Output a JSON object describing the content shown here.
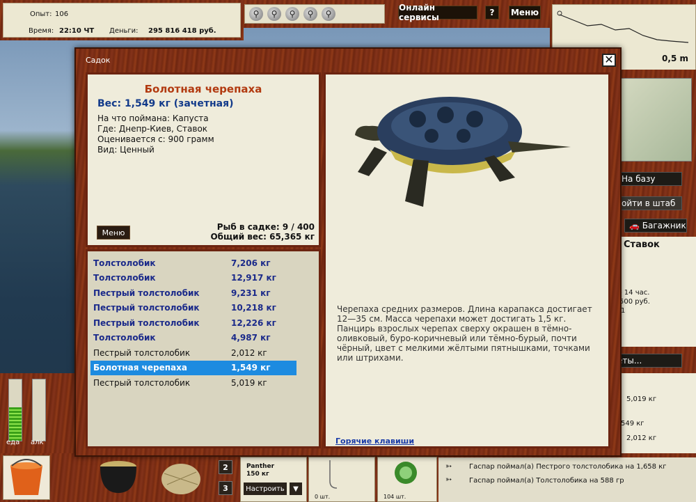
{
  "stats": {
    "exp_label": "Опыт:",
    "exp_value": "106",
    "time_label": "Время:",
    "time_value": "22:10 ЧТ",
    "money_label": "Деньги:",
    "money_value": "295 816 418 руб."
  },
  "topbar": {
    "online": "Онлайн сервисы",
    "help": "?",
    "menu": "Меню"
  },
  "depth": {
    "value": "0,5 m"
  },
  "right": {
    "to_base": "На базу",
    "go_hq": "ойти в штаб",
    "trunk": "Багажник",
    "location_title": "Ставок",
    "line1": "- 14 час.",
    "line2": "500 руб.",
    "line3": "1",
    "tickets": "еты...",
    "w1": "5,019 кг",
    "w2": "549 кг",
    "w3": "2,012 кг"
  },
  "modal": {
    "title": "Садок",
    "close": "✕",
    "fish_name": "Болотная черепаха",
    "weight": "Вес: 1,549 кг (зачетная)",
    "bait": "На что поймана: Капуста",
    "place": "Где: Днепр-Киев, Ставок",
    "rated": "Оценивается с: 900 грамм",
    "kind": "Вид: Ценный",
    "menu_btn": "Меню",
    "count": "Рыб в садке: 9 / 400",
    "total": "Общий вес: 65,365 кг",
    "description": "Черепаха средних размеров. Длина карапакса достигает 12—35 см. Масса черепахи может достигать 1,5 кг. Панцирь взрослых черепах сверху окрашен в тёмно-оливковый, буро-коричневый или тёмно-бурый, почти чёрный, цвет с мелкими жёлтыми пятнышками, точками или штрихами.",
    "hotkeys": "Горячие клавиши",
    "catches": [
      {
        "name": "Толстолобик",
        "weight": "7,206 кг",
        "style": "b"
      },
      {
        "name": "Толстолобик",
        "weight": "12,917 кг",
        "style": "b"
      },
      {
        "name": "Пестрый толстолобик",
        "weight": "9,231 кг",
        "style": "b"
      },
      {
        "name": "Пестрый толстолобик",
        "weight": "10,218 кг",
        "style": "b"
      },
      {
        "name": "Пестрый толстолобик",
        "weight": "12,226 кг",
        "style": "b"
      },
      {
        "name": "Толстолобик",
        "weight": "4,987 кг",
        "style": "b"
      },
      {
        "name": "Пестрый толстолобик",
        "weight": "2,012 кг",
        "style": "n"
      },
      {
        "name": "Болотная черепаха",
        "weight": "1,549 кг",
        "style": "sel"
      },
      {
        "name": "Пестрый толстолобик",
        "weight": "5,019 кг",
        "style": "n"
      }
    ]
  },
  "bottom": {
    "food_label": "еда",
    "alc_label": "алк",
    "food_level": 0.55,
    "alc_level": 0.0,
    "btn2": "2",
    "btn3": "3",
    "lure_name": "Panther",
    "lure_weight": "150 кг",
    "setup": "Настроить",
    "down": "▼",
    "slot1_count": "0 шт.",
    "slot2_count": "104 шт.",
    "log1": "Гаспар поймал(а) Пестрого толстолобика на 1,658 кг",
    "log2": "Гаспар поймал(а) Толстолобика на 588 гр"
  }
}
